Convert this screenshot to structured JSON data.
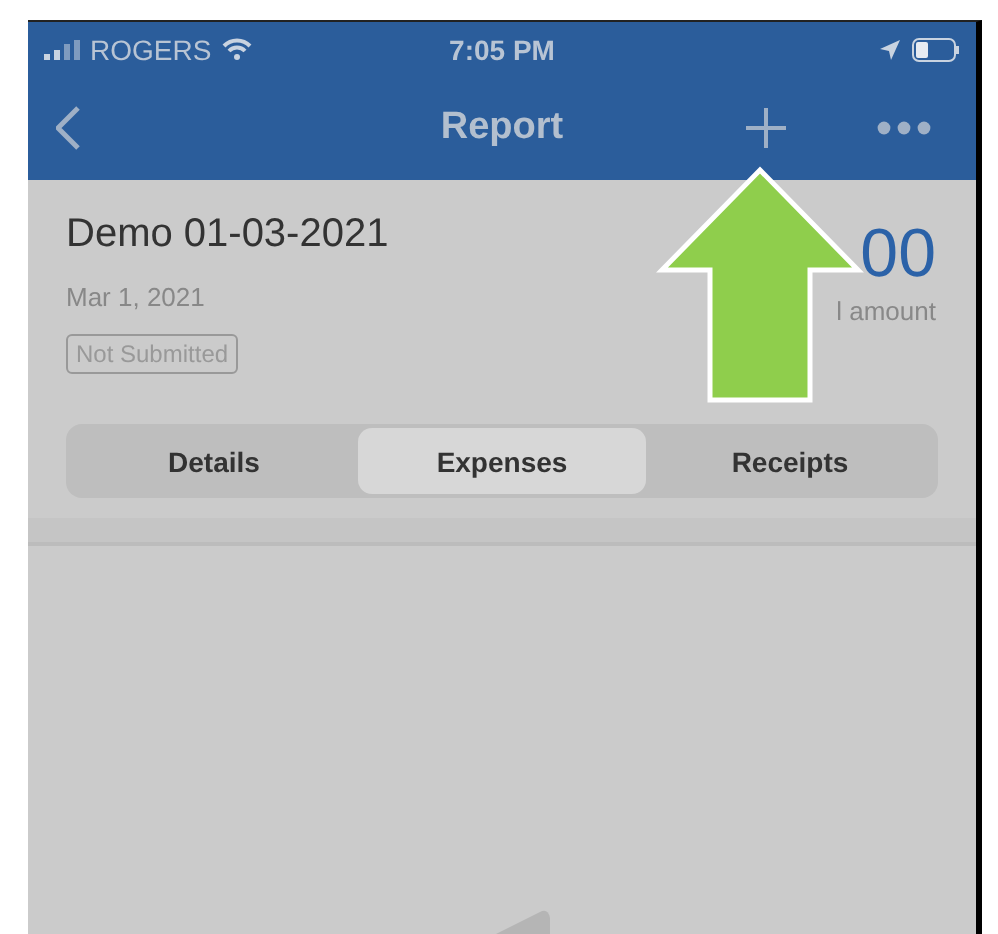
{
  "status_bar": {
    "carrier": "ROGERS",
    "time": "7:05 PM"
  },
  "nav_bar": {
    "title": "Report"
  },
  "report": {
    "name": "Demo 01-03-2021",
    "date": "Mar 1, 2021",
    "status": "Not Submitted",
    "amount": "00",
    "amount_label": "l amount"
  },
  "tabs": [
    {
      "label": "Details",
      "selected": false
    },
    {
      "label": "Expenses",
      "selected": true
    },
    {
      "label": "Receipts",
      "selected": false
    }
  ]
}
